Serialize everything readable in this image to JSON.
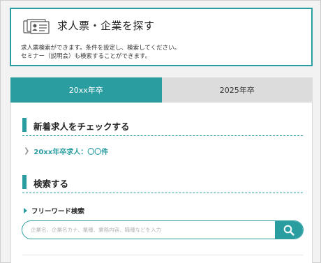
{
  "header": {
    "icon": "id-card-icon",
    "title": "求人票・企業を探す",
    "desc_line1": "求人票検索ができます。条件を設定し、検索してください。",
    "desc_line2": "セミナー（説明会）も検索することができます。"
  },
  "tabs": [
    {
      "label": "20xx年卒",
      "active": true
    },
    {
      "label": "2025年卒",
      "active": false
    }
  ],
  "sections": {
    "new_jobs": {
      "heading": "新着求人をチェックする",
      "link_text": "20xx年卒求人：〇〇件"
    },
    "search": {
      "heading": "検索する",
      "freeword_label": "フリーワード検索",
      "placeholder": "企業名、企業名カナ、業種、業務内容、職種などを入力",
      "value": "",
      "button_icon": "search-icon"
    }
  },
  "colors": {
    "accent": "#2a9da1",
    "tab_inactive": "#dcdcdc",
    "background": "#f2f2f2"
  }
}
